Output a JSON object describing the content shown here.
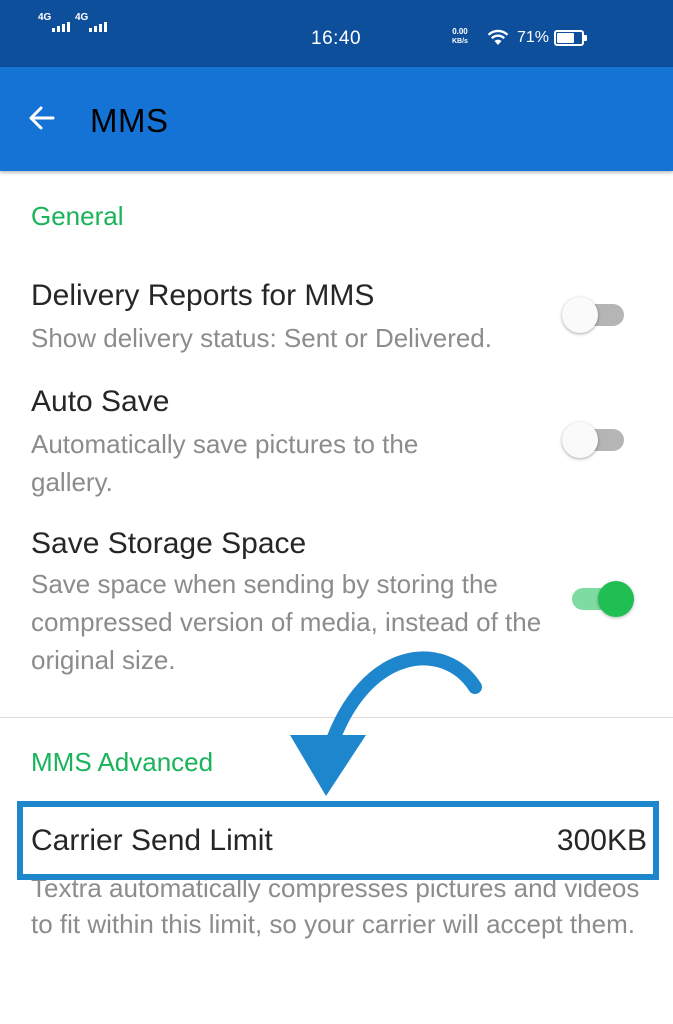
{
  "status_bar": {
    "signal_1_network": "4G",
    "signal_2_network": "4G",
    "time": "16:40",
    "speed_value": "0.00",
    "speed_unit": "KB/s",
    "battery_percent": "71%",
    "battery_level": 0.71
  },
  "app_bar": {
    "title": "MMS",
    "back_icon": "arrow-left-icon"
  },
  "general": {
    "header": "General",
    "items": [
      {
        "title": "Delivery Reports for MMS",
        "summary": "Show delivery status: Sent or Delivered.",
        "enabled": false
      },
      {
        "title": "Auto Save",
        "summary": "Automatically save pictures to the gallery.",
        "enabled": false
      },
      {
        "title": "Save Storage Space",
        "summary": "Save space when sending by storing the compressed version of media, instead of the original size.",
        "enabled": true
      }
    ]
  },
  "advanced": {
    "header": "MMS Advanced",
    "carrier_limit_label": "Carrier Send Limit",
    "carrier_limit_value": "300KB",
    "carrier_limit_summary": "Textra automatically compresses pictures and videos to fit within this limit, so your carrier will accept them."
  },
  "colors": {
    "status_bar": "#0e4f9c",
    "app_bar": "#1473d5",
    "section_header": "#19b35a",
    "switch_on": "#1fbf54",
    "highlight_border": "#1e86cc",
    "annotation_arrow": "#1e86cc"
  }
}
